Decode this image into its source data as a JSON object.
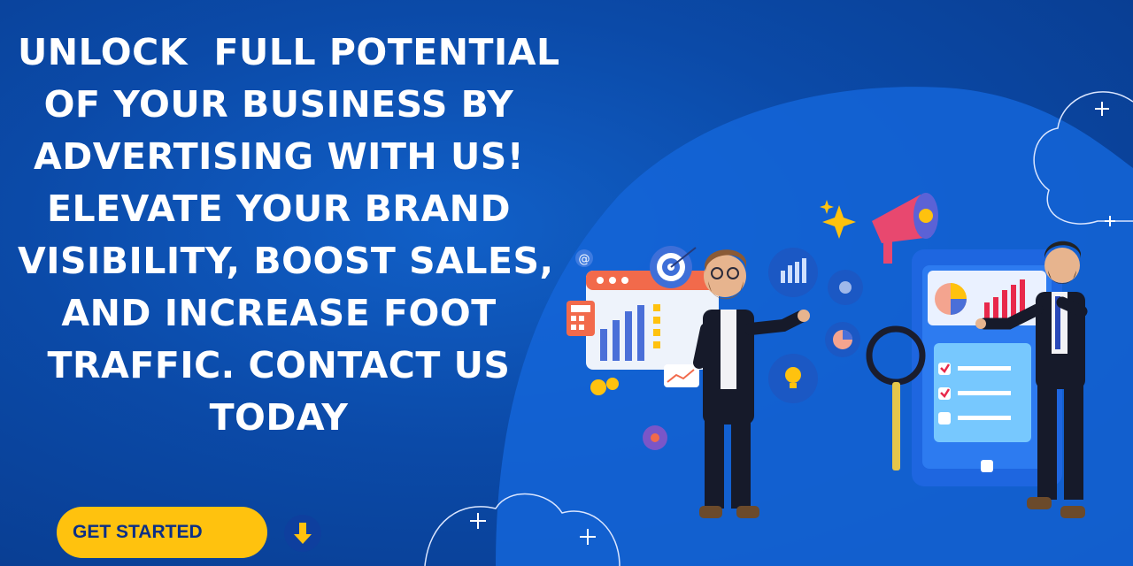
{
  "headline": {
    "lines": [
      "UNLOCK  FULL POTENTIAL",
      "OF YOUR BUSINESS BY",
      "ADVERTISING WITH US!",
      "ELEVATE YOUR BRAND",
      "VISIBILITY, BOOST SALES,",
      "AND INCREASE FOOT",
      "TRAFFIC. CONTACT US",
      "TODAY"
    ]
  },
  "cta": {
    "label": "GET STARTED"
  },
  "colors": {
    "background": "#0b4aa8",
    "accent": "#ffc20e",
    "text": "#ffffff",
    "cta_text": "#0b2f86"
  },
  "icons": [
    "down-arrow-icon",
    "megaphone-icon",
    "target-icon",
    "gear-icon",
    "lightbulb-icon",
    "magnifier-icon",
    "pie-chart-icon",
    "bar-chart-icon",
    "sparkle-icon",
    "at-sign-icon",
    "calculator-icon"
  ]
}
